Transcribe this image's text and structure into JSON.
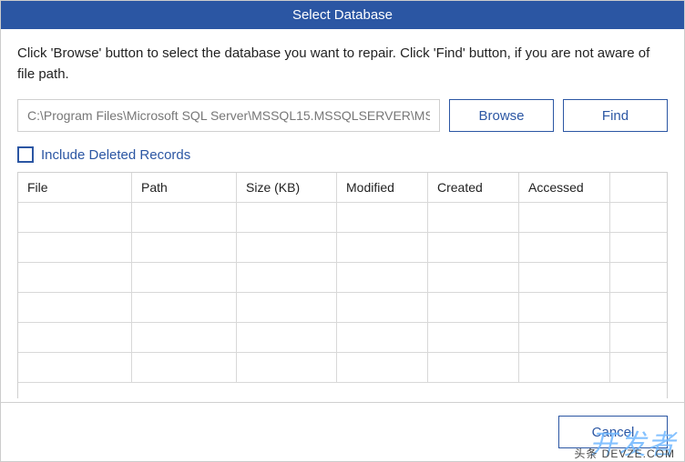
{
  "title": "Select Database",
  "instruction": "Click 'Browse' button to select the database you want to repair. Click 'Find' button, if you are not aware of file path.",
  "path_input": {
    "value": "C:\\Program Files\\Microsoft SQL Server\\MSSQL15.MSSQLSERVER\\MS"
  },
  "buttons": {
    "browse": "Browse",
    "find": "Find",
    "cancel": "Cancel"
  },
  "checkbox": {
    "include_deleted_label": "Include Deleted Records",
    "checked": false
  },
  "table": {
    "columns": [
      "File",
      "Path",
      "Size (KB)",
      "Modified",
      "Created",
      "Accessed",
      ""
    ],
    "rows": [
      [
        "",
        "",
        "",
        "",
        "",
        "",
        ""
      ],
      [
        "",
        "",
        "",
        "",
        "",
        "",
        ""
      ],
      [
        "",
        "",
        "",
        "",
        "",
        "",
        ""
      ],
      [
        "",
        "",
        "",
        "",
        "",
        "",
        ""
      ],
      [
        "",
        "",
        "",
        "",
        "",
        "",
        ""
      ],
      [
        "",
        "",
        "",
        "",
        "",
        "",
        ""
      ]
    ]
  },
  "watermark": {
    "main": "开发者",
    "sub": "头条 DEVZE.COM"
  }
}
